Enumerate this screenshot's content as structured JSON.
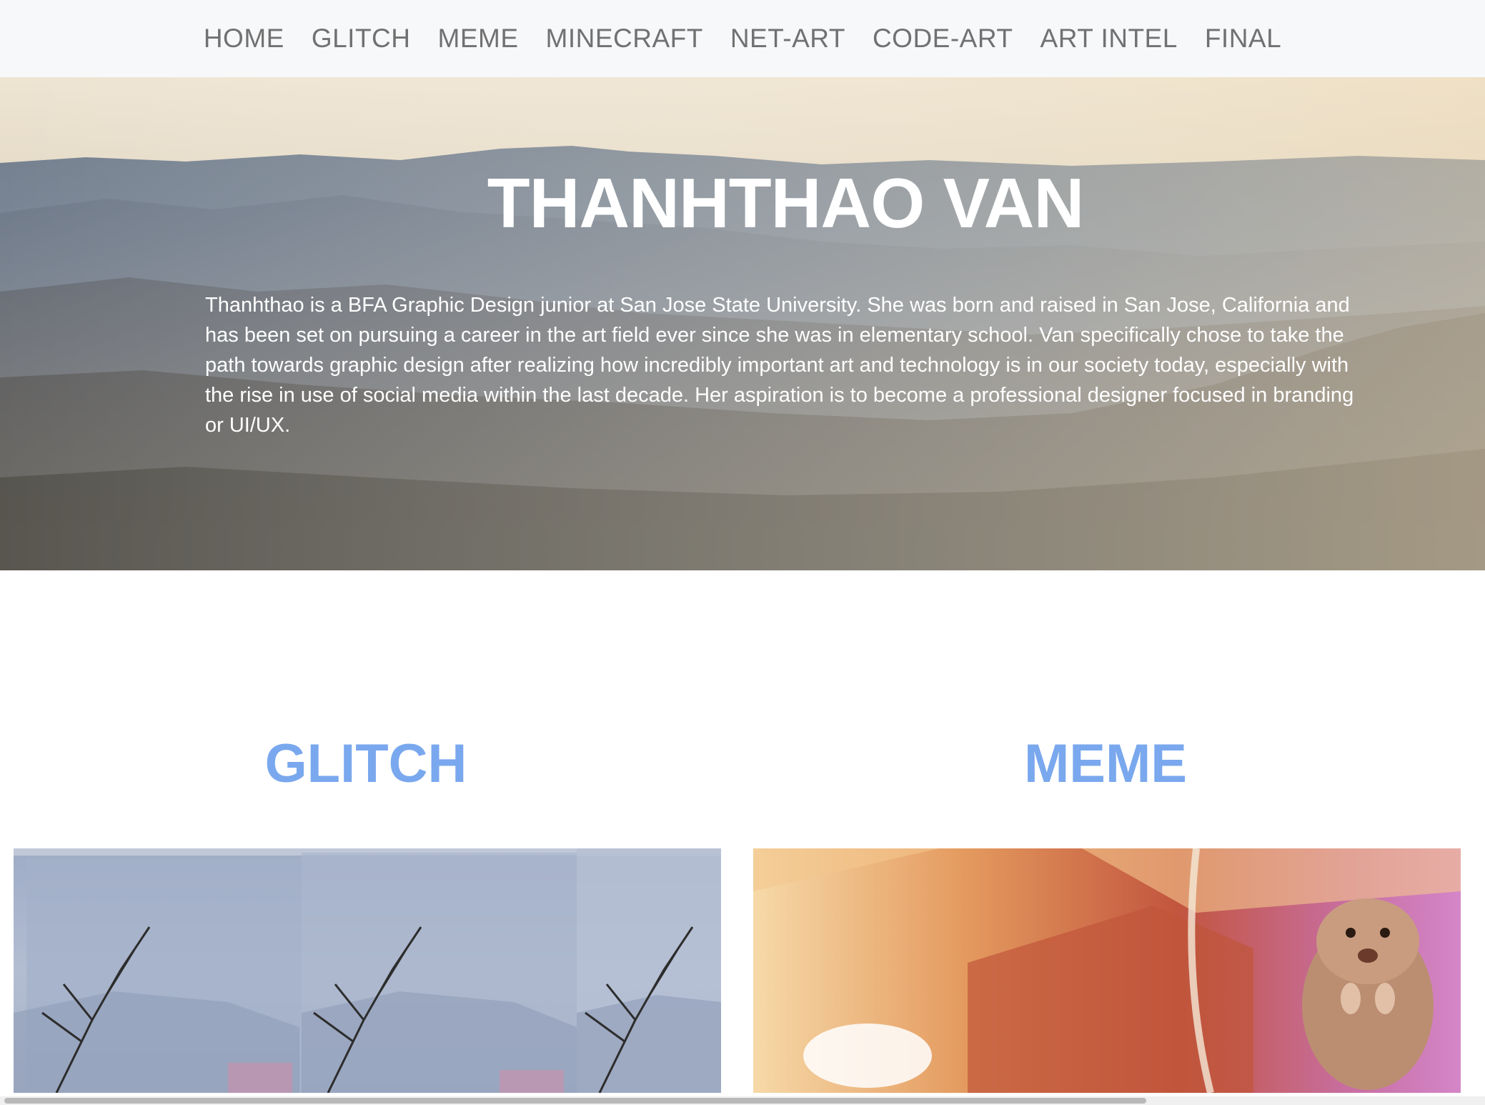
{
  "nav": {
    "items": [
      "HOME",
      "GLITCH",
      "MEME",
      "MINECRAFT",
      "NET-ART",
      "CODE-ART",
      "ART INTEL",
      "FINAL"
    ]
  },
  "hero": {
    "title": "THANHTHAO VAN",
    "bio": "Thanhthao is a BFA Graphic Design junior at San Jose State University. She was born and raised in San Jose, California and has been set on pursuing a career in the art field ever since she was in elementary school. Van specifically chose to take the path towards graphic design after realizing how incredibly important art and technology is in our society today, especially with the rise in use of social media within the last decade. Her aspiration is to become a professional designer focused in branding or UI/UX."
  },
  "sections": {
    "glitch": {
      "heading": "GLITCH"
    },
    "meme": {
      "heading": "MEME"
    }
  },
  "colors": {
    "nav_bg": "#f7f8fa",
    "nav_text": "#717171",
    "heading_accent": "#7aa8ee",
    "hero_text": "#ffffff"
  }
}
